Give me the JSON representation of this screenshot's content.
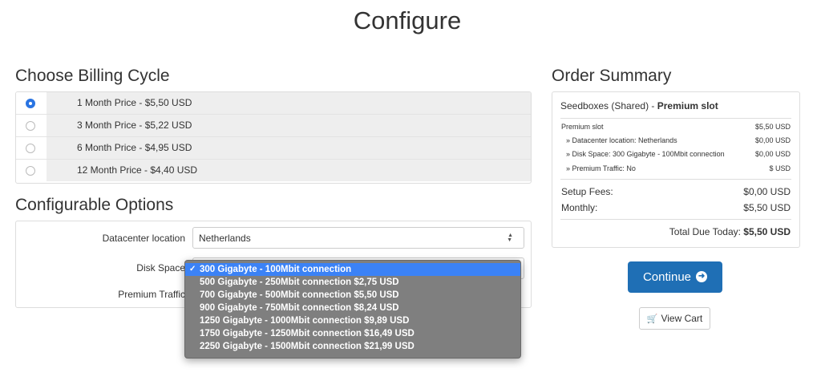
{
  "page": {
    "title": "Configure"
  },
  "billing": {
    "title": "Choose Billing Cycle",
    "options": [
      {
        "label": "1 Month Price - $5,50 USD",
        "checked": true
      },
      {
        "label": "3 Month Price - $5,22 USD",
        "checked": false
      },
      {
        "label": "6 Month Price - $4,95 USD",
        "checked": false
      },
      {
        "label": "12 Month Price - $4,40 USD",
        "checked": false
      }
    ]
  },
  "config": {
    "title": "Configurable Options",
    "datacenter": {
      "label": "Datacenter location",
      "value": "Netherlands"
    },
    "disk_space": {
      "label": "Disk Space"
    },
    "premium_traffic": {
      "label": "Premium Traffic"
    }
  },
  "dropdown": {
    "items": [
      "300 Gigabyte - 100Mbit connection",
      "500 Gigabyte - 250Mbit connection $2,75 USD",
      "700 Gigabyte - 500Mbit connection $5,50 USD",
      "900 Gigabyte - 750Mbit connection $8,24 USD",
      "1250 Gigabyte - 1000Mbit connection $9,89 USD",
      "1750 Gigabyte - 1250Mbit connection $16,49 USD",
      "2250 Gigabyte - 1500Mbit connection $21,99 USD"
    ],
    "selected_index": 0,
    "check": "✓"
  },
  "summary": {
    "title": "Order Summary",
    "product_group": "Seedboxes (Shared) - ",
    "product_name": "Premium slot",
    "lines": [
      {
        "label": "Premium slot",
        "value": "$5,50 USD"
      },
      {
        "label": "» Datacenter location: Netherlands",
        "value": "$0,00 USD"
      },
      {
        "label": "» Disk Space: 300 Gigabyte - 100Mbit connection",
        "value": "$0,00 USD"
      },
      {
        "label": "» Premium Traffic: No",
        "value": "$ USD"
      }
    ],
    "setup_label": "Setup Fees:",
    "setup_value": "$0,00 USD",
    "monthly_label": "Monthly:",
    "monthly_value": "$5,50 USD",
    "total_label": "Total Due Today:",
    "total_value": "$5,50 USD"
  },
  "actions": {
    "continue_label": "Continue",
    "view_cart_label": "View Cart"
  },
  "icons": {
    "continue": "arrow-circle-right-icon",
    "cart": "shopping-cart-icon"
  },
  "colors": {
    "primary": "#1f6fb5",
    "radio_checked": "#2a74e2",
    "dropdown_bg": "#7f7f7f",
    "dropdown_selected": "#3b82f6"
  }
}
